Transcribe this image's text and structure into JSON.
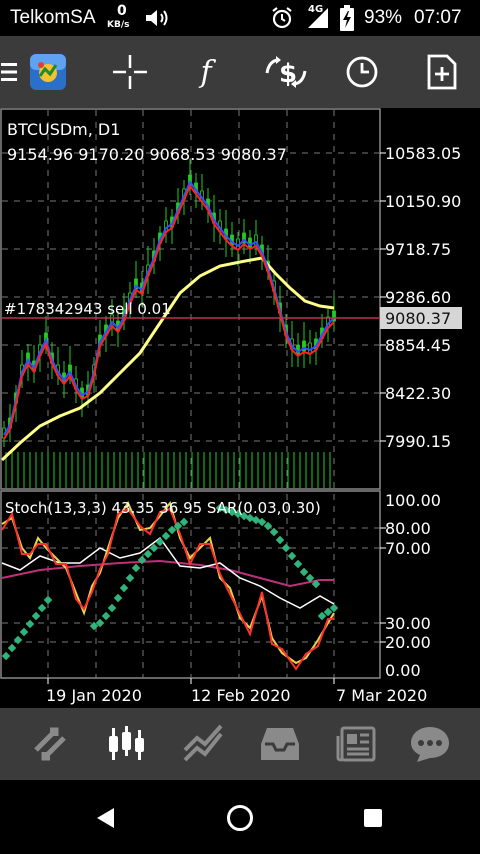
{
  "status_bar": {
    "carrier": "TelkomSA",
    "net_speed_value": "0",
    "net_speed_unit": "KB/s",
    "network_type": "4G",
    "battery": "93%",
    "time": "07:07"
  },
  "chart": {
    "symbol_timeframe": "BTCUSDm, D1",
    "ohlc": "9154.96 9170.20 9068.53 9080.37",
    "order_label": "#178342943 sell 0.01",
    "current_price": "9080.37",
    "price_ticks": [
      "10583.05",
      "10150.90",
      "9718.75",
      "9286.60",
      "8854.45",
      "8422.30",
      "7990.15"
    ],
    "indicator_label": "Stoch(13,3,3) 43.35 36.95 SAR(0.03,0.30)",
    "indicator_ticks": [
      "100.00",
      "80.00",
      "70.00",
      "30.00",
      "20.00",
      "0.00"
    ],
    "date_ticks": [
      "19 Jan 2020",
      "12 Feb 2020",
      "7 Mar 2020"
    ]
  },
  "colors": {
    "price_line": "#e0303a",
    "ma_fast": "#ff2020",
    "ma_slow": "#ffff88",
    "candles": "#22cc22",
    "sar": "#2fb57b",
    "stoch_main": "#e0d84a",
    "stoch_signal": "#ff3030",
    "white_line": "#ffffff",
    "magenta_line": "#c0307a",
    "order_line": "#c03050",
    "toolbar_bg": "#3b3b3b"
  },
  "toolbar_icons": [
    "menu-icon",
    "metatrader-logo-icon",
    "crosshair-icon",
    "function-icon",
    "dollar-arrows-icon",
    "clock-icon",
    "new-document-icon"
  ],
  "bottom_nav_icons": [
    "quotes-icon",
    "chart-icon",
    "trade-icon",
    "history-icon",
    "news-icon",
    "chat-icon"
  ]
}
